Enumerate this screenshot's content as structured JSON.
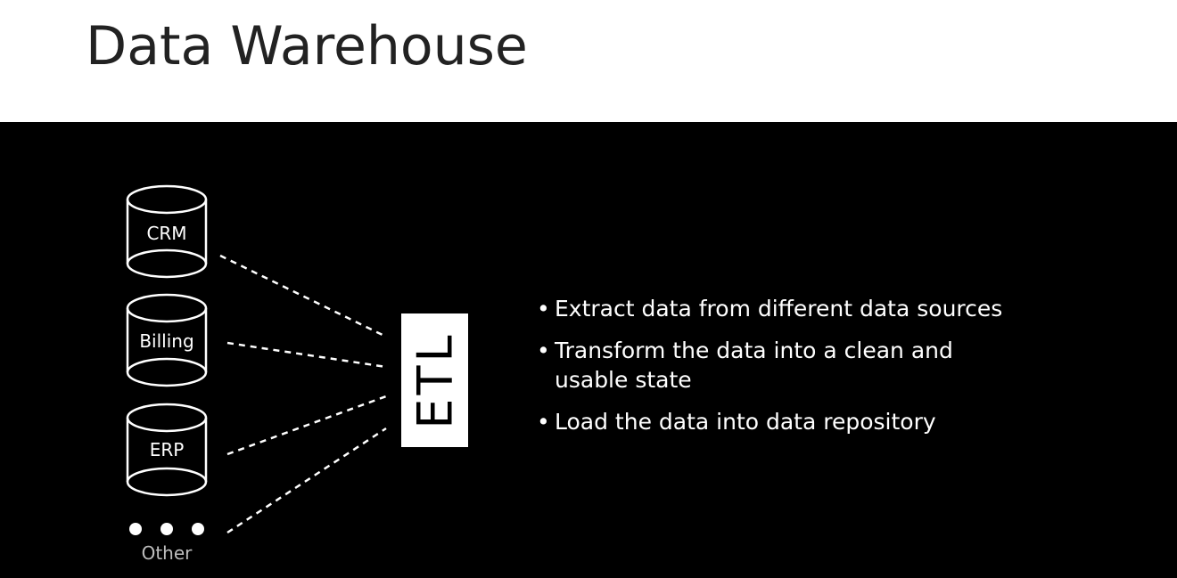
{
  "header": {
    "title": "Data Warehouse"
  },
  "sources": [
    {
      "label": "CRM"
    },
    {
      "label": "Billing"
    },
    {
      "label": "ERP"
    }
  ],
  "other_label": "Other",
  "etl_label": "ETL",
  "bullets": [
    {
      "text": "Extract data from different data sources"
    },
    {
      "text": "Transform the data into a clean and usable state"
    },
    {
      "text": "Load the data into data repository"
    }
  ],
  "colors": {
    "header_bg": "#ffffff",
    "slide_bg": "#000000",
    "title_text": "#222222",
    "foreground": "#ffffff",
    "other_text": "#bdbdbd"
  }
}
